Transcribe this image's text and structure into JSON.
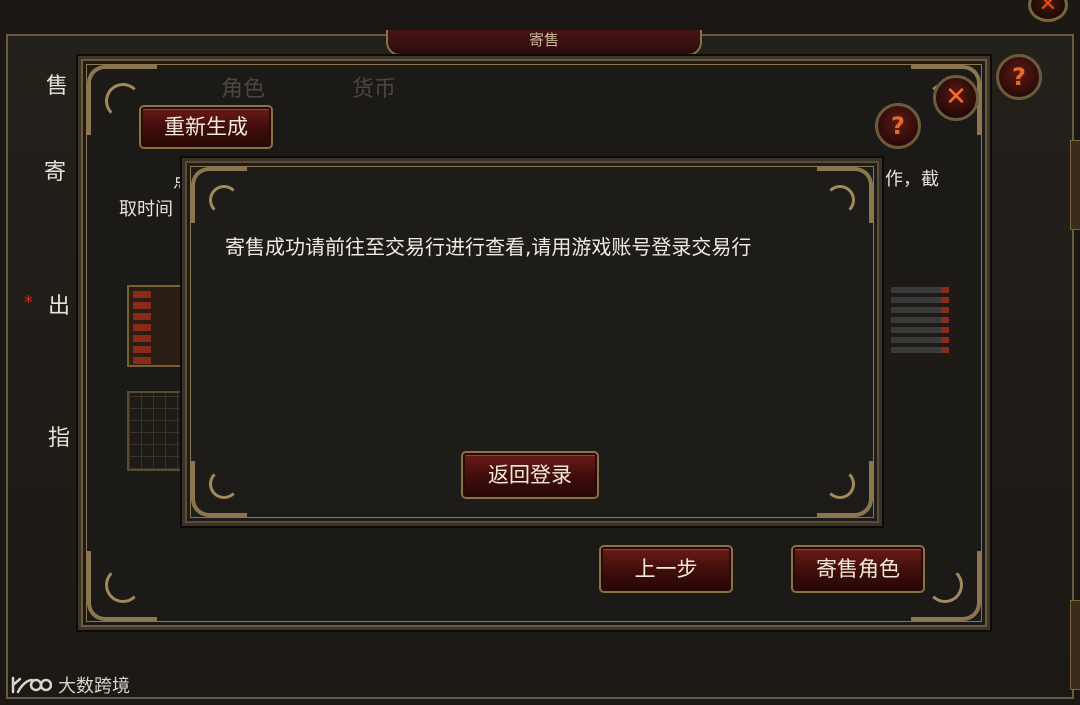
{
  "background_window": {
    "title": "寄售",
    "close_symbol": "✕",
    "help_symbol": "?",
    "side_labels": [
      "售",
      "寄",
      "出",
      "指"
    ],
    "required_marker": "*"
  },
  "middle_panel": {
    "tabs": [
      "角色",
      "货币"
    ],
    "regenerate_label": "重新生成",
    "help_symbol": "?",
    "close_symbol": "✕",
    "text_fragments": [
      "点",
      "取时间",
      "作，截"
    ],
    "prev_step_label": "上一步",
    "consign_character_label": "寄售角色"
  },
  "dialog": {
    "message": "寄售成功请前往至交易行进行查看,请用游戏账号登录交易行",
    "return_login_label": "返回登录"
  },
  "watermark": {
    "text": "大数跨境"
  },
  "colors": {
    "button_red": "#4a1210",
    "gold_trim": "#8c7650",
    "close_orange": "#ff6a2a",
    "panel_dark": "#1e1c19"
  }
}
